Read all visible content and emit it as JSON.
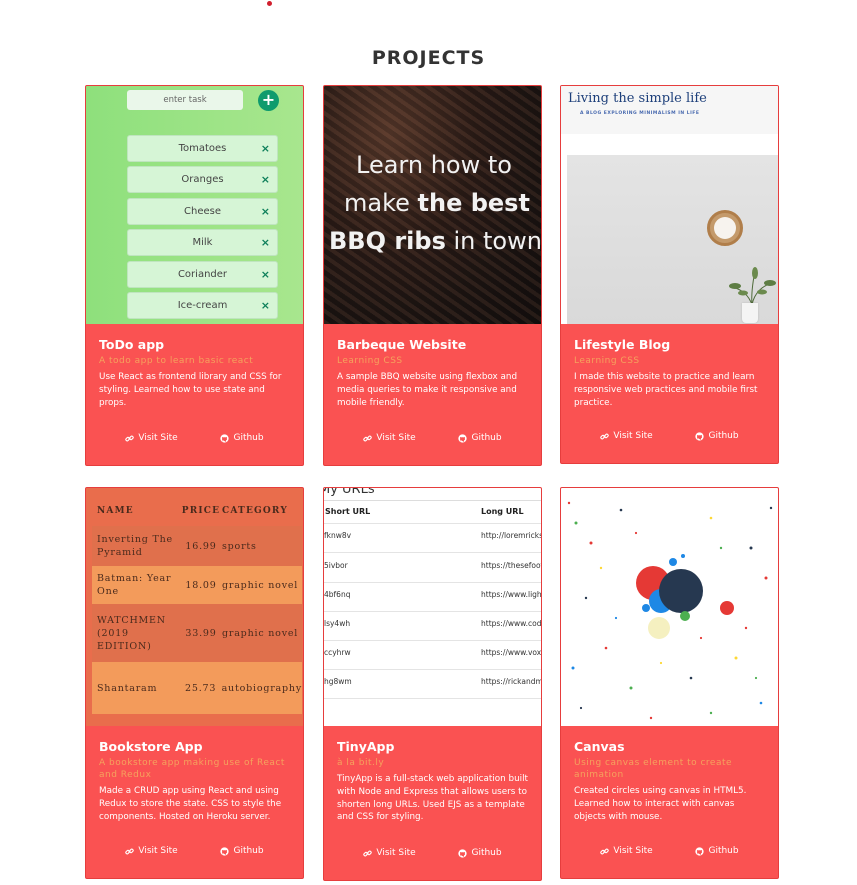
{
  "section_title": "PROJECTS",
  "link_labels": {
    "visit": "Visit Site",
    "github": "Github"
  },
  "projects": [
    {
      "title": "ToDo app",
      "subtitle": "A todo app to learn basic react",
      "description": "Use React as frontend library and CSS for styling. Learned how to use state and props.",
      "screenshot": {
        "input_placeholder": "enter task",
        "add_icon": "+",
        "items": [
          "Tomatoes",
          "Oranges",
          "Cheese",
          "Milk",
          "Coriander",
          "Ice-cream"
        ],
        "remove_icon": "×"
      }
    },
    {
      "title": "Barbeque Website",
      "subtitle": "Learning CSS",
      "description": "A sample BBQ website using flexbox and media queries to make it responsive and mobile friendly.",
      "screenshot": {
        "line1": "Learn how to",
        "line2_a": "make ",
        "line2_b": "the best",
        "line3_a": "BBQ ribs",
        "line3_b": " in town"
      }
    },
    {
      "title": "Lifestyle Blog",
      "subtitle": "Learning CSS",
      "description": "I made this website to practice and learn responsive web practices and mobile first practice.",
      "screenshot": {
        "blog_title": "Living the simple life",
        "tagline": "A BLOG EXPLORING MINIMALISM IN LIFE"
      }
    },
    {
      "title": "Bookstore App",
      "subtitle": "A bookstore app making use of React and Redux",
      "description": "Made a CRUD app using React and using Redux to store the state. CSS to style the components. Hosted on Heroku server.",
      "screenshot": {
        "headers": [
          "NAME",
          "PRICE",
          "CATEGORY"
        ],
        "rows": [
          [
            "Inverting The Pyramid",
            "16.99",
            "sports"
          ],
          [
            "Batman: Year One",
            "18.09",
            "graphic novel"
          ],
          [
            "WATCHMEN (2019 EDITION)",
            "33.99",
            "graphic novel"
          ],
          [
            "Shantaram",
            "25.73",
            "autobiography"
          ]
        ]
      }
    },
    {
      "title": "TinyApp",
      "subtitle": "à la bit.ly",
      "description": "TinyApp is a full-stack web application built with Node and Express that allows users to shorten long URLs. Used EJS as a template and CSS for styling.",
      "screenshot": {
        "heading": "My URLs",
        "headers": [
          "Short URL",
          "Long URL"
        ],
        "rows": [
          [
            "fknw8v",
            "http://loremricksu"
          ],
          [
            "5ivbor",
            "https://thesefootb"
          ],
          [
            "4bf6nq",
            "https://www.lighth"
          ],
          [
            "lsy4wh",
            "https://www.codeb"
          ],
          [
            "ccyhrw",
            "https://www.vox.c"
          ],
          [
            "hg8wm",
            "https://rickandmo"
          ]
        ]
      }
    },
    {
      "title": "Canvas",
      "subtitle": "Using canvas element to create animation",
      "description": "Created circles using canvas in HTML5. Learned how to interact with canvas objects with mouse."
    }
  ],
  "icons": {
    "visit": "link-icon",
    "github": "github-icon"
  },
  "colors": {
    "card": "#fa5252",
    "subtitle": "#f5a25d",
    "accent_dot": "#d11f2e"
  }
}
